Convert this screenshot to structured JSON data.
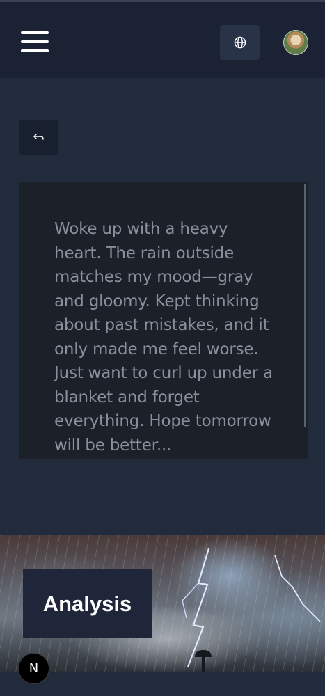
{
  "header": {
    "menu_icon": "hamburger-menu-icon",
    "language_icon": "globe-icon",
    "avatar_icon": "user-avatar"
  },
  "navigation": {
    "back_icon": "back-arrow-icon"
  },
  "journal_entry": {
    "text": "Woke up with a heavy heart. The rain outside matches my mood—gray and gloomy. Kept thinking about past mistakes, and it only made me feel worse. Just want to curl up under a blanket and forget everything. Hope tomorrow will be better..."
  },
  "analysis": {
    "label": "Analysis",
    "image_icon": "stormy-rain-illustration"
  },
  "footer": {
    "badge": "N"
  },
  "colors": {
    "background": "#222b3b",
    "header": "#1b2233",
    "card": "#1c2029",
    "entry_text": "#8a909b"
  }
}
